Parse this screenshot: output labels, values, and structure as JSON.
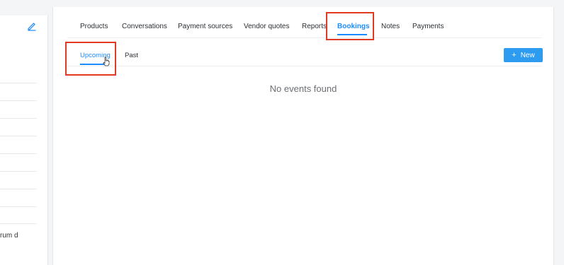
{
  "left_panel": {
    "edit_icon": "pencil-icon",
    "truncated_text": "rum d"
  },
  "tabs": [
    {
      "label": "Products",
      "active": false
    },
    {
      "label": "Conversations",
      "active": false
    },
    {
      "label": "Payment sources",
      "active": false
    },
    {
      "label": "Vendor quotes",
      "active": false
    },
    {
      "label": "Reports",
      "active": false
    },
    {
      "label": "Bookings",
      "active": true
    },
    {
      "label": "Notes",
      "active": false
    },
    {
      "label": "Payments",
      "active": false
    }
  ],
  "subtabs": [
    {
      "label": "Upcoming",
      "active": true
    },
    {
      "label": "Past",
      "active": false
    }
  ],
  "new_button": {
    "icon": "plus-icon",
    "label": "New"
  },
  "empty_state": "No events found",
  "colors": {
    "accent": "#1a8cff",
    "button": "#2d9bf0",
    "highlight": "#e03a24"
  }
}
